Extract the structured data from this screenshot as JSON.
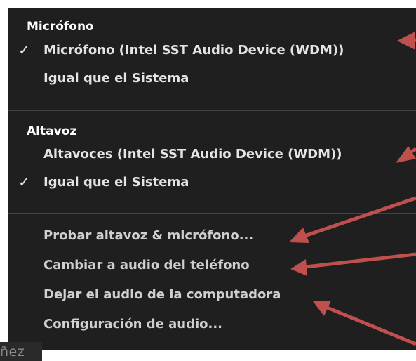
{
  "menu": {
    "sections": [
      {
        "header": "Micrófono",
        "items": [
          {
            "label": "Micrófono (Intel SST Audio Device (WDM))",
            "checked": true
          },
          {
            "label": "Igual que el Sistema",
            "checked": false
          }
        ]
      },
      {
        "header": "Altavoz",
        "items": [
          {
            "label": "Altavoces (Intel SST Audio Device (WDM))",
            "checked": false
          },
          {
            "label": "Igual que el Sistema",
            "checked": true
          }
        ]
      }
    ],
    "actions": [
      "Probar altavoz & micrófono...",
      "Cambiar a audio del teléfono",
      "Dejar el audio de la computadora",
      "Configuración de audio..."
    ],
    "check_glyph": "✓"
  },
  "background_fragment": "ñez",
  "annotation_color": "#c0504d"
}
